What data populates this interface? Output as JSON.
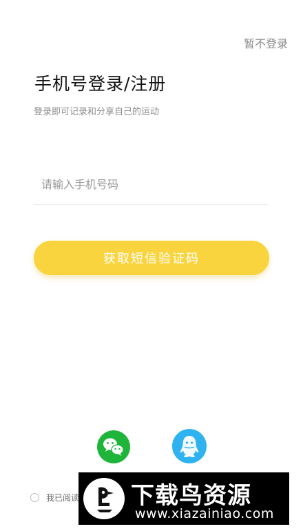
{
  "header": {
    "skip_label": "暂不登录",
    "title": "手机号登录/注册",
    "subtitle": "登录即可记录和分享自己的运动"
  },
  "form": {
    "phone_placeholder": "请输入手机号码",
    "phone_value": "",
    "sms_button_label": "获取短信验证码"
  },
  "colors": {
    "accent": "#fad43f",
    "wechat": "#1fb53a",
    "qq": "#2fb2f0"
  },
  "social": {
    "wechat_icon": "wechat-icon",
    "qq_icon": "qq-icon"
  },
  "agreement": {
    "text": "我已阅读"
  },
  "watermark": {
    "title": "下载鸟资源",
    "url": "www.xiazainiao.com"
  }
}
